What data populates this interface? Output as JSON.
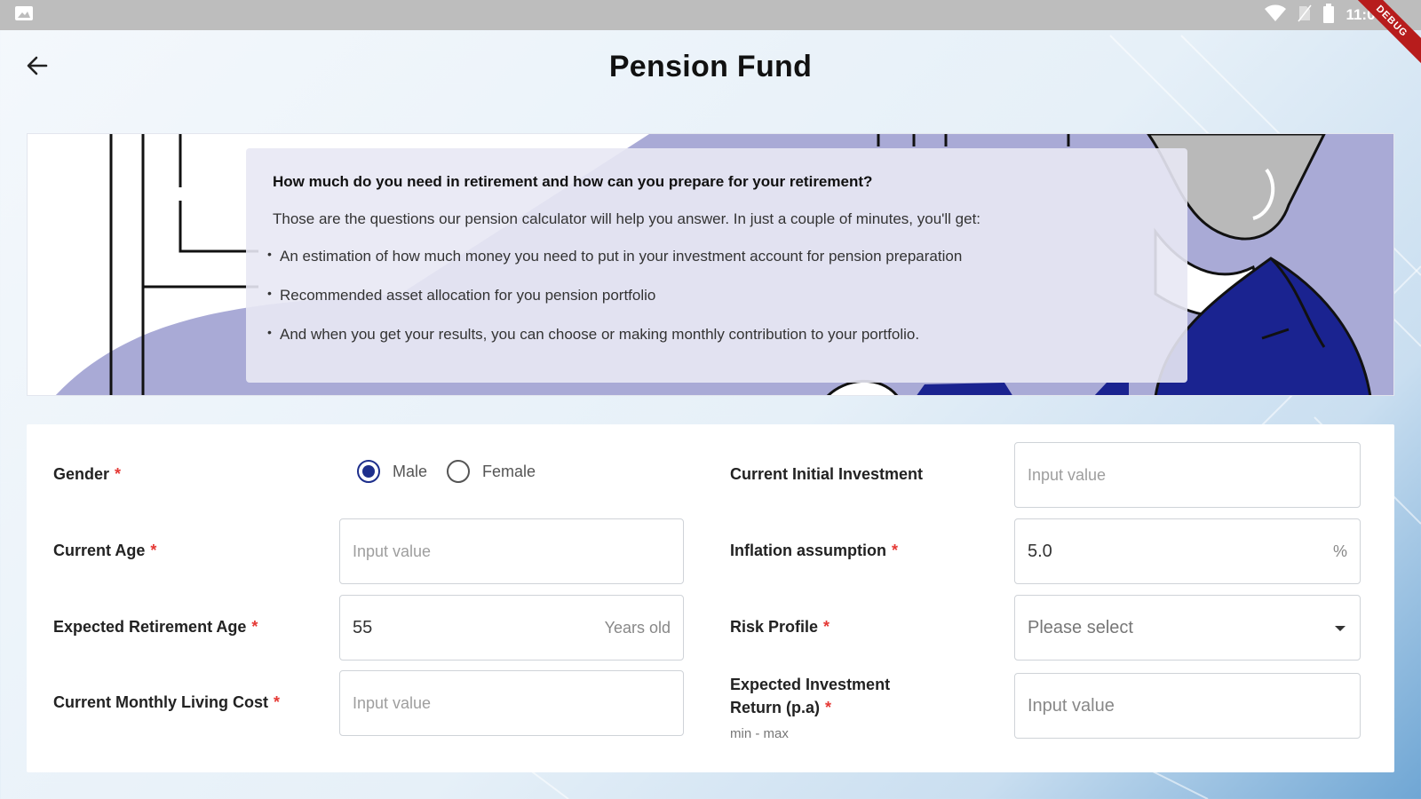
{
  "status_bar": {
    "time": "11:09",
    "badge": "DEBUG",
    "icons": [
      "image-icon",
      "wifi-icon",
      "no-sim-icon",
      "battery-icon"
    ]
  },
  "header": {
    "title": "Pension Fund",
    "back_icon": "arrow-left-icon"
  },
  "banner": {
    "heading": "How much do you need in retirement and how can you prepare for your retirement?",
    "intro": "Those are the questions our pension calculator will help you answer. In just a couple of minutes, you'll get:",
    "bullets": [
      "An estimation of how much money you need to put in your investment account for pension preparation",
      "Recommended asset allocation for you pension portfolio",
      "And when you get your results, you can choose or making monthly contribution to your portfolio."
    ]
  },
  "form": {
    "gender": {
      "label": "Gender",
      "required": "*",
      "options": [
        "Male",
        "Female"
      ],
      "selected": "Male"
    },
    "current_age": {
      "label": "Current Age",
      "required": "*",
      "placeholder": "Input value",
      "value": ""
    },
    "retirement_age": {
      "label": "Expected Retirement Age",
      "required": "*",
      "value": "55",
      "suffix": "Years old"
    },
    "living_cost": {
      "label": "Current Monthly Living Cost",
      "required": "*",
      "placeholder": "Input value",
      "value": ""
    },
    "initial_investment": {
      "label": "Current Initial Investment",
      "placeholder": "Input value",
      "value": ""
    },
    "inflation": {
      "label": "Inflation assumption",
      "required": "*",
      "value": "5.0",
      "suffix": "%"
    },
    "risk_profile": {
      "label": "Risk Profile",
      "required": "*",
      "placeholder": "Please select",
      "icon": "caret-down-icon"
    },
    "investment_return": {
      "label": "Expected Investment Return (p.a)",
      "required": "*",
      "sublabel": "min - max",
      "placeholder": "Input value",
      "value": ""
    }
  },
  "colors": {
    "accent": "#1e2f8c",
    "required": "#e53935",
    "banner_purple": "#a9aad6",
    "banner_navy": "#1a2390",
    "status_bar": "#bdbdbd"
  }
}
